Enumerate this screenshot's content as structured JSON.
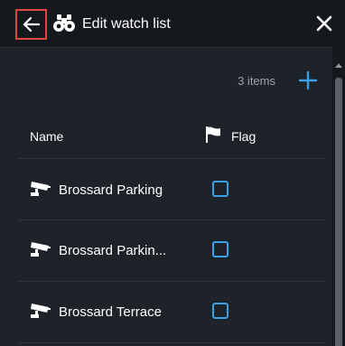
{
  "header": {
    "title": "Edit watch list",
    "back_icon": "arrow-left-icon",
    "title_icon": "binoculars-icon",
    "close_icon": "close-icon"
  },
  "toolbar": {
    "items_count": "3 items",
    "add_icon": "plus-icon"
  },
  "table": {
    "columns": {
      "name": "Name",
      "flag": "Flag",
      "flag_icon": "flag-icon"
    },
    "rows": [
      {
        "icon": "camera-icon",
        "label": "Brossard Parking",
        "flagged": false
      },
      {
        "icon": "camera-icon",
        "label": "Brossard Parkin...",
        "flagged": false
      },
      {
        "icon": "camera-icon",
        "label": "Brossard Terrace",
        "flagged": false
      }
    ]
  },
  "colors": {
    "accent": "#3aa0e8",
    "highlight_border": "#e0463c",
    "background": "#1e2229",
    "header_background": "#15181d"
  }
}
